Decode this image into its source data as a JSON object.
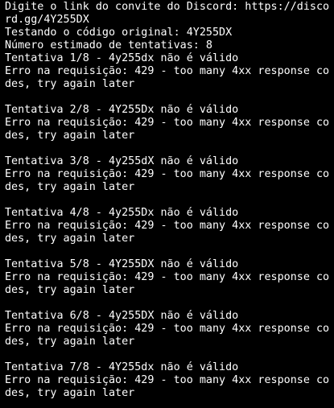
{
  "terminal": {
    "background": "#000000",
    "foreground": "#ffffff",
    "lines": [
      "Digite o link do convite do Discord: https://disco",
      "rd.gg/4Y255DX",
      "Testando o código original: 4Y255DX",
      "Número estimado de tentativas: 8",
      "Tentativa 1/8 - 4y255dx não é válido",
      "Erro na requisição: 429 - too many 4xx response co",
      "des, try again later",
      "",
      "Tentativa 2/8 - 4Y255Dx não é válido",
      "Erro na requisição: 429 - too many 4xx response co",
      "des, try again later",
      "",
      "Tentativa 3/8 - 4y255dX não é válido",
      "Erro na requisição: 429 - too many 4xx response co",
      "des, try again later",
      "",
      "Tentativa 4/8 - 4y255Dx não é válido",
      "Erro na requisição: 429 - too many 4xx response co",
      "des, try again later",
      "",
      "Tentativa 5/8 - 4Y255DX não é válido",
      "Erro na requisição: 429 - too many 4xx response co",
      "des, try again later",
      "",
      "Tentativa 6/8 - 4y255DX não é válido",
      "Erro na requisição: 429 - too many 4xx response co",
      "des, try again later",
      "",
      "Tentativa 7/8 - 4Y255dx não é válido",
      "Erro na requisição: 429 - too many 4xx response co",
      "des, try again later"
    ]
  }
}
